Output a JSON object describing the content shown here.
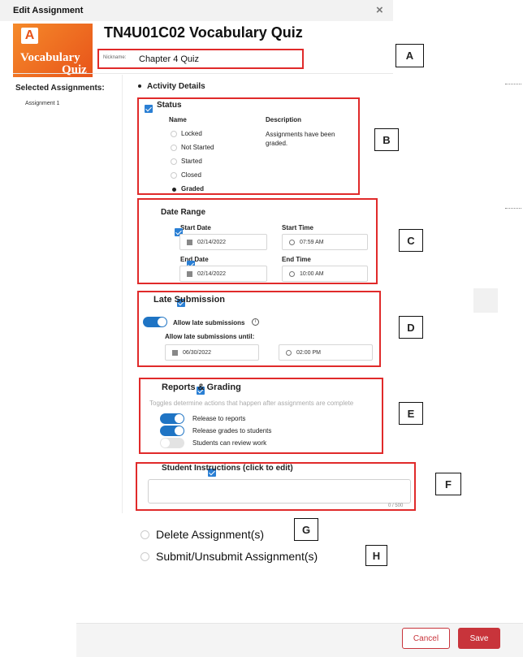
{
  "dialog": {
    "title": "Edit Assignment",
    "close_symbol": "×",
    "quiz_title": "TN4U01C02 Vocabulary Quiz",
    "logo_letter": "A",
    "logo_line1": "Vocabulary",
    "logo_line2": "Quiz",
    "nickname_label": "Nickname:",
    "nickname_value": "Chapter 4 Quiz"
  },
  "sidebar": {
    "heading": "Selected Assignments:",
    "items": [
      "Assignment 1"
    ]
  },
  "activity_details": {
    "heading": "Activity Details"
  },
  "status": {
    "heading": "Status",
    "col_name": "Name",
    "col_description": "Description",
    "options": [
      "Locked",
      "Not Started",
      "Started",
      "Closed",
      "Graded"
    ],
    "selected": "Graded",
    "description": "Assignments have been graded."
  },
  "date_range": {
    "heading": "Date Range",
    "start_date_label": "Start Date",
    "start_time_label": "Start Time",
    "start_date": "02/14/2022",
    "start_time": "07:59 AM",
    "end_date_label": "End Date",
    "end_time_label": "End Time",
    "end_date": "02/14/2022",
    "end_time": "10:00 AM"
  },
  "late_submission": {
    "heading": "Late Submission",
    "allow_label": "Allow late submissions",
    "until_label": "Allow late submissions until:",
    "until_date": "06/30/2022",
    "until_time": "02:00 PM"
  },
  "reports": {
    "heading": "Reports & Grading",
    "hint": "Toggles determine actions that happen after assignments are complete",
    "toggles": [
      {
        "label": "Release to reports",
        "on": true
      },
      {
        "label": "Release grades to students",
        "on": true
      },
      {
        "label": "Students can review work",
        "on": false
      }
    ]
  },
  "instructions": {
    "heading": "Student Instructions (click to edit)",
    "counter": "0 / 500"
  },
  "actions": {
    "delete_label": "Delete Assignment(s)",
    "submit_label": "Submit/Unsubmit Assignment(s)"
  },
  "footer": {
    "cancel_label": "Cancel",
    "save_label": "Save"
  },
  "callouts": [
    "A",
    "B",
    "C",
    "D",
    "E",
    "F",
    "G",
    "H"
  ],
  "colors": {
    "accent_blue": "#1f74c4",
    "callout_red": "#e02a2a",
    "save_red": "#c8343b",
    "logo_orange": "#f26a1b"
  }
}
